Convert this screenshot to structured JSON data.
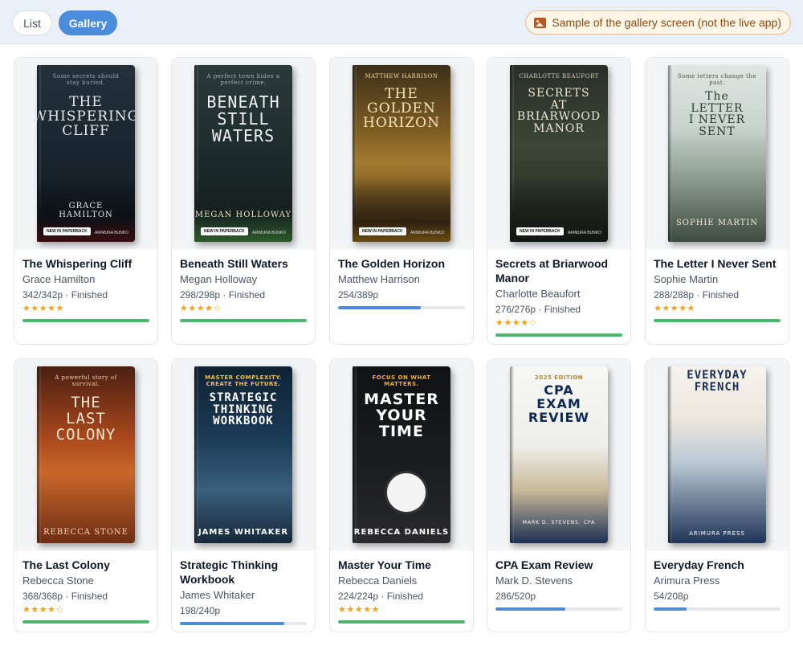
{
  "toolbar": {
    "list_label": "List",
    "gallery_label": "Gallery",
    "sample_label": "Sample of the gallery screen (not the live app)",
    "sample_icon": "image-icon"
  },
  "colors": {
    "accent": "#4a8bdc",
    "finished": "#4cb86f",
    "stars": "#f3a11a",
    "badge_border": "#e7b98f"
  },
  "books": [
    {
      "title": "The Whispering Cliff",
      "author": "Grace Hamilton",
      "meta": "342/342p · Finished",
      "stars": "★★★★★",
      "progress": 1.0,
      "status": "finished",
      "cover": {
        "tagline": "Some secrets should stay buried.",
        "title": "THE\nWHISPERING\nCLIFF",
        "author": "GRACE\nHAMILTON",
        "badge": "NEW IN PAPERBACK",
        "publisher": "ARIMURA BUNKO"
      }
    },
    {
      "title": "Beneath Still Waters",
      "author": "Megan Holloway",
      "meta": "298/298p · Finished",
      "stars": "★★★★☆",
      "progress": 1.0,
      "status": "finished",
      "cover": {
        "tagline": "A perfect town hides a perfect crime.",
        "title": "BENEATH\nSTILL\nWATERS",
        "author": "MEGAN HOLLOWAY",
        "badge": "NEW IN PAPERBACK",
        "publisher": "ARIMURA BUNKO"
      }
    },
    {
      "title": "The Golden Horizon",
      "author": "Matthew Harrison",
      "meta": "254/389p",
      "stars": "",
      "progress": 0.653,
      "status": "reading",
      "cover": {
        "tagline": "MATTHEW HARRISON",
        "title": "THE\nGOLDEN\nHORIZON",
        "author": "",
        "badge": "NEW IN PAPERBACK",
        "publisher": "ARIMURA BUNKO"
      }
    },
    {
      "title": "Secrets at Briarwood Manor",
      "author": "Charlotte Beaufort",
      "meta": "276/276p · Finished",
      "stars": "★★★★☆",
      "progress": 1.0,
      "status": "finished",
      "cover": {
        "tagline": "CHARLOTTE BEAUFORT",
        "title": "SECRETS\nAT\nBRIARWOOD\nMANOR",
        "author": "",
        "badge": "NEW IN PAPERBACK",
        "publisher": "ARIMURA BUNKO"
      }
    },
    {
      "title": "The Letter I Never Sent",
      "author": "Sophie Martin",
      "meta": "288/288p · Finished",
      "stars": "★★★★★",
      "progress": 1.0,
      "status": "finished",
      "cover": {
        "tagline": "Some letters change the past.",
        "title": "The\nLETTER\nI NEVER\nSENT",
        "author": "SOPHIE MARTIN",
        "badge": "",
        "publisher": ""
      }
    },
    {
      "title": "The Last Colony",
      "author": "Rebecca Stone",
      "meta": "368/368p · Finished",
      "stars": "★★★★☆",
      "progress": 1.0,
      "status": "finished",
      "cover": {
        "tagline": "A powerful story of survival.",
        "title": "THE\nLAST\nCOLONY",
        "author": "REBECCA STONE",
        "badge": "",
        "publisher": ""
      }
    },
    {
      "title": "Strategic Thinking Workbook",
      "author": "James Whitaker",
      "meta": "198/240p",
      "stars": "",
      "progress": 0.825,
      "status": "reading",
      "cover": {
        "tagline": "MASTER COMPLEXITY. CREATE THE FUTURE.",
        "title": "STRATEGIC\nTHINKING\nWORKBOOK",
        "author": "JAMES WHITAKER",
        "badge": "",
        "publisher": ""
      }
    },
    {
      "title": "Master Your Time",
      "author": "Rebecca Daniels",
      "meta": "224/224p · Finished",
      "stars": "★★★★★",
      "progress": 1.0,
      "status": "finished",
      "cover": {
        "tagline": "FOCUS ON WHAT MATTERS.",
        "title": "MASTER\nYOUR\nTIME",
        "author": "REBECCA DANIELS",
        "badge": "",
        "publisher": ""
      }
    },
    {
      "title": "CPA Exam Review",
      "author": "Mark D. Stevens",
      "meta": "286/520p",
      "stars": "",
      "progress": 0.55,
      "status": "reading",
      "cover": {
        "tagline": "2025 EDITION",
        "title": "CPA\nEXAM REVIEW",
        "author": "MARK D. STEVENS, CPA",
        "badge": "",
        "publisher": ""
      }
    },
    {
      "title": "Everyday French",
      "author": "Arimura Press",
      "meta": "54/208p",
      "stars": "",
      "progress": 0.26,
      "status": "reading",
      "cover": {
        "tagline": "",
        "title": "EVERYDAY\nFRENCH",
        "author": "ARIMURA PRESS",
        "badge": "",
        "publisher": ""
      }
    }
  ]
}
